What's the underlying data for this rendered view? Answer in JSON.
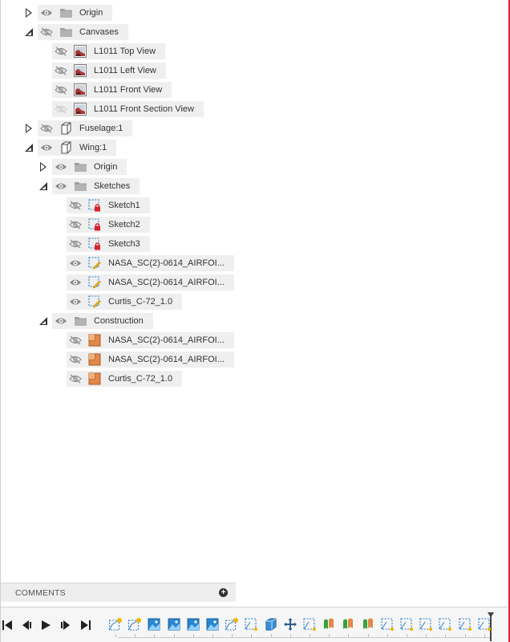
{
  "browser": {
    "items": [
      {
        "label": "Origin",
        "icon": "folder-icon",
        "visibility": "visible",
        "expander": "collapsed"
      },
      {
        "label": "Canvases",
        "icon": "folder-icon",
        "visibility": "hidden",
        "expander": "expanded"
      },
      {
        "label": "L1011 Top View",
        "icon": "canvas-image-icon",
        "visibility": "hidden",
        "expander": "none"
      },
      {
        "label": "L1011 Left View",
        "icon": "canvas-image-icon",
        "visibility": "hidden",
        "expander": "none"
      },
      {
        "label": "L1011 Front View",
        "icon": "canvas-image-icon",
        "visibility": "hidden",
        "expander": "none"
      },
      {
        "label": "L1011 Front Section View",
        "icon": "canvas-image-icon",
        "visibility": "dim",
        "expander": "none"
      },
      {
        "label": "Fuselage:1",
        "icon": "component-icon",
        "visibility": "hidden",
        "expander": "collapsed"
      },
      {
        "label": "Wing:1",
        "icon": "component-icon",
        "visibility": "visible",
        "expander": "expanded"
      },
      {
        "label": "Origin",
        "icon": "folder-icon",
        "visibility": "visible",
        "expander": "collapsed"
      },
      {
        "label": "Sketches",
        "icon": "folder-icon",
        "visibility": "visible",
        "expander": "expanded"
      },
      {
        "label": "Sketch1",
        "icon": "sketch-locked-icon",
        "visibility": "hidden",
        "expander": "none"
      },
      {
        "label": "Sketch2",
        "icon": "sketch-locked-icon",
        "visibility": "hidden",
        "expander": "none"
      },
      {
        "label": "Sketch3",
        "icon": "sketch-locked-icon",
        "visibility": "hidden",
        "expander": "none"
      },
      {
        "label": "NASA_SC(2)-0614_AIRFOI...",
        "icon": "sketch-edit-icon",
        "visibility": "visible",
        "expander": "none"
      },
      {
        "label": "NASA_SC(2)-0614_AIRFOI...",
        "icon": "sketch-edit-icon",
        "visibility": "visible",
        "expander": "none"
      },
      {
        "label": "Curtis_C-72_1.0",
        "icon": "sketch-edit-icon",
        "visibility": "visible",
        "expander": "none"
      },
      {
        "label": "Construction",
        "icon": "folder-icon",
        "visibility": "visible",
        "expander": "expanded"
      },
      {
        "label": "NASA_SC(2)-0614_AIRFOI...",
        "icon": "construction-plane-icon",
        "visibility": "hidden",
        "expander": "none"
      },
      {
        "label": "NASA_SC(2)-0614_AIRFOI...",
        "icon": "construction-plane-icon",
        "visibility": "hidden",
        "expander": "none"
      },
      {
        "label": "Curtis_C-72_1.0",
        "icon": "construction-plane-icon",
        "visibility": "hidden",
        "expander": "none"
      }
    ]
  },
  "comments": {
    "title": "COMMENTS",
    "add_icon": "plus-circle-icon"
  },
  "timeline": {
    "playback": [
      "skip-to-start-icon",
      "step-back-icon",
      "play-icon",
      "step-forward-icon",
      "skip-to-end-icon"
    ],
    "features": [
      "sketch-feature-icon",
      "sketch-feature-icon",
      "canvas-feature-icon",
      "canvas-feature-icon",
      "canvas-feature-icon",
      "canvas-feature-icon",
      "sketch-feature-icon",
      "sketch-select-icon",
      "component-feature-icon",
      "move-feature-icon",
      "sketch-select-icon",
      "loft-feature-icon",
      "loft-feature-icon",
      "loft-feature-icon",
      "sketch-select-icon",
      "sketch-select-icon",
      "sketch-select-icon",
      "sketch-select-icon",
      "sketch-select-icon",
      "sketch-select-icon"
    ]
  },
  "colors": {
    "accent_blue": "#2b7fc9",
    "sketch_red": "#d9232d",
    "folder_gray": "#9c9c9c",
    "construction_orange": "#e0894a",
    "sketch_yellow": "#f0b400"
  }
}
